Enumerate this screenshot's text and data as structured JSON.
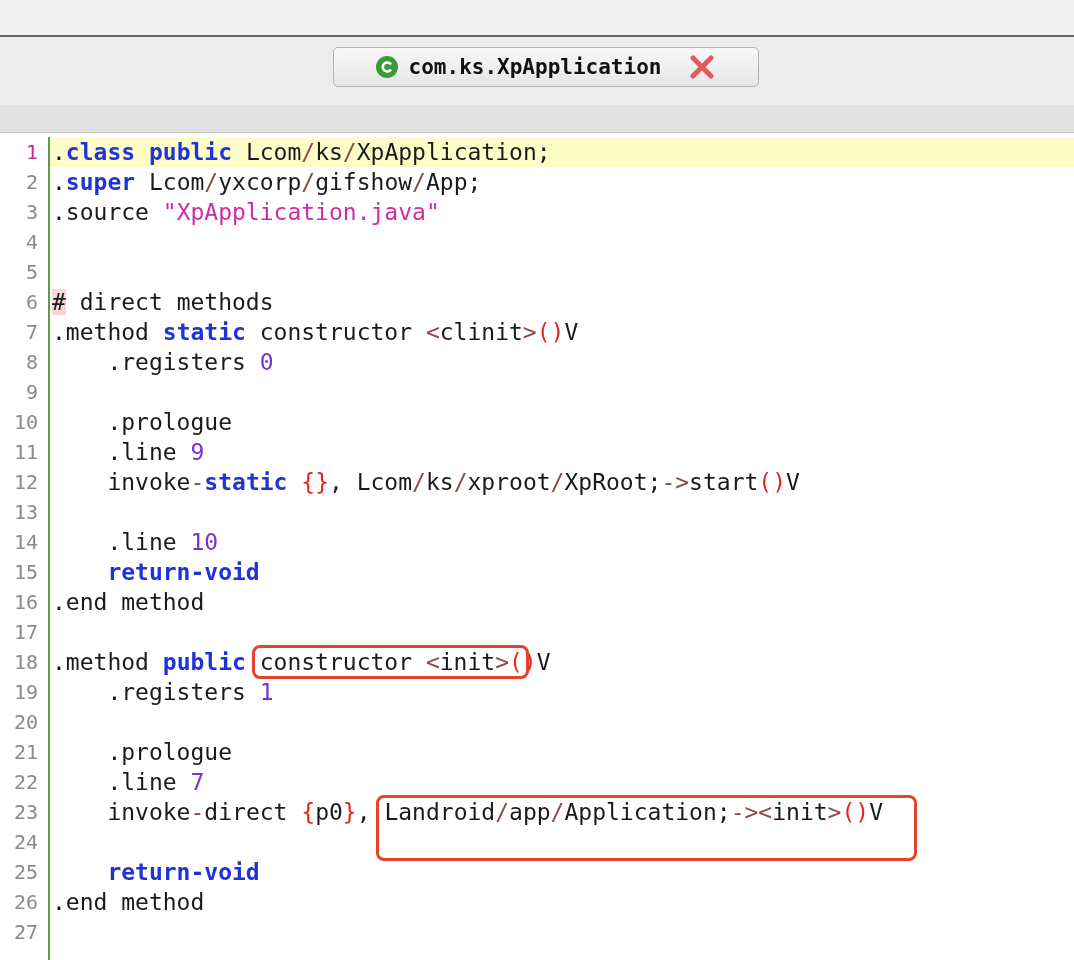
{
  "tab": {
    "title": "com.ks.XpApplication"
  },
  "lines": [
    {
      "number": "1",
      "current": true,
      "tokens": [
        {
          "text": ".",
          "kind": "plain"
        },
        {
          "text": "class ",
          "kind": "keyword"
        },
        {
          "text": "public",
          "kind": "keyword"
        },
        {
          "text": " Lcom",
          "kind": "plain"
        },
        {
          "text": "/",
          "kind": "op"
        },
        {
          "text": "ks",
          "kind": "plain"
        },
        {
          "text": "/",
          "kind": "op"
        },
        {
          "text": "XpApplication;",
          "kind": "plain"
        }
      ]
    },
    {
      "number": "2",
      "current": false,
      "tokens": [
        {
          "text": ".",
          "kind": "plain"
        },
        {
          "text": "super",
          "kind": "keyword"
        },
        {
          "text": " Lcom",
          "kind": "plain"
        },
        {
          "text": "/",
          "kind": "op"
        },
        {
          "text": "yxcorp",
          "kind": "plain"
        },
        {
          "text": "/",
          "kind": "op"
        },
        {
          "text": "gifshow",
          "kind": "plain"
        },
        {
          "text": "/",
          "kind": "op"
        },
        {
          "text": "App;",
          "kind": "plain"
        }
      ]
    },
    {
      "number": "3",
      "current": false,
      "tokens": [
        {
          "text": ".source ",
          "kind": "plain"
        },
        {
          "text": "\"XpApplication.java\"",
          "kind": "string"
        }
      ]
    },
    {
      "number": "4",
      "current": false
    },
    {
      "number": "5",
      "current": false
    },
    {
      "number": "6",
      "current": false,
      "tokens": [
        {
          "text": "#",
          "kind": "mark"
        },
        {
          "text": " direct methods",
          "kind": "plain"
        }
      ]
    },
    {
      "number": "7",
      "current": false,
      "tokens": [
        {
          "text": ".method ",
          "kind": "plain"
        },
        {
          "text": "static",
          "kind": "keyword"
        },
        {
          "text": " constructor ",
          "kind": "plain"
        },
        {
          "text": "<",
          "kind": "op"
        },
        {
          "text": "clinit",
          "kind": "plain"
        },
        {
          "text": ">",
          "kind": "op"
        },
        {
          "text": "()",
          "kind": "paren"
        },
        {
          "text": "V",
          "kind": "plain"
        }
      ]
    },
    {
      "number": "8",
      "current": false,
      "tokens": [
        {
          "text": "    .registers ",
          "kind": "plain"
        },
        {
          "text": "0",
          "kind": "number"
        }
      ]
    },
    {
      "number": "9",
      "current": false
    },
    {
      "number": "10",
      "current": false,
      "tokens": [
        {
          "text": "    .prologue",
          "kind": "plain"
        }
      ]
    },
    {
      "number": "11",
      "current": false,
      "tokens": [
        {
          "text": "    .line ",
          "kind": "plain"
        },
        {
          "text": "9",
          "kind": "number"
        }
      ]
    },
    {
      "number": "12",
      "current": false,
      "tokens": [
        {
          "text": "    invoke",
          "kind": "plain"
        },
        {
          "text": "-",
          "kind": "op"
        },
        {
          "text": "static ",
          "kind": "keyword"
        },
        {
          "text": "{}",
          "kind": "paren"
        },
        {
          "text": ", Lcom",
          "kind": "plain"
        },
        {
          "text": "/",
          "kind": "op"
        },
        {
          "text": "ks",
          "kind": "plain"
        },
        {
          "text": "/",
          "kind": "op"
        },
        {
          "text": "xproot",
          "kind": "plain"
        },
        {
          "text": "/",
          "kind": "op"
        },
        {
          "text": "XpRoot;",
          "kind": "plain"
        },
        {
          "text": "->",
          "kind": "op"
        },
        {
          "text": "start",
          "kind": "plain"
        },
        {
          "text": "()",
          "kind": "paren"
        },
        {
          "text": "V",
          "kind": "plain"
        }
      ]
    },
    {
      "number": "13",
      "current": false
    },
    {
      "number": "14",
      "current": false,
      "tokens": [
        {
          "text": "    .line ",
          "kind": "plain"
        },
        {
          "text": "10",
          "kind": "number"
        }
      ]
    },
    {
      "number": "15",
      "current": false,
      "tokens": [
        {
          "text": "    return-void",
          "kind": "keyword"
        }
      ]
    },
    {
      "number": "16",
      "current": false,
      "tokens": [
        {
          "text": ".end method",
          "kind": "plain"
        }
      ]
    },
    {
      "number": "17",
      "current": false
    },
    {
      "number": "18",
      "current": false,
      "tokens": [
        {
          "text": ".method ",
          "kind": "plain"
        },
        {
          "text": "public ",
          "kind": "keyword"
        }
      ],
      "box": {
        "tall": false,
        "tokens": [
          {
            "text": "constructor ",
            "kind": "plain"
          },
          {
            "text": "<",
            "kind": "op"
          },
          {
            "text": "init",
            "kind": "plain"
          },
          {
            "text": ">",
            "kind": "op"
          },
          {
            "text": "(",
            "kind": "paren"
          }
        ]
      },
      "rest": [
        {
          "text": ")",
          "kind": "paren"
        },
        {
          "text": "V",
          "kind": "plain"
        }
      ]
    },
    {
      "number": "19",
      "current": false,
      "tokens": [
        {
          "text": "    .registers ",
          "kind": "plain"
        },
        {
          "text": "1",
          "kind": "number"
        }
      ]
    },
    {
      "number": "20",
      "current": false
    },
    {
      "number": "21",
      "current": false,
      "tokens": [
        {
          "text": "    .prologue",
          "kind": "plain"
        }
      ]
    },
    {
      "number": "22",
      "current": false,
      "tokens": [
        {
          "text": "    .line ",
          "kind": "plain"
        },
        {
          "text": "7",
          "kind": "number"
        }
      ]
    },
    {
      "number": "23",
      "current": false,
      "tokens": [
        {
          "text": "    invoke",
          "kind": "plain"
        },
        {
          "text": "-",
          "kind": "op"
        },
        {
          "text": "direct ",
          "kind": "plain"
        },
        {
          "text": "{",
          "kind": "paren"
        },
        {
          "text": "p0",
          "kind": "plain"
        },
        {
          "text": "}",
          "kind": "paren"
        },
        {
          "text": ", ",
          "kind": "plain"
        }
      ],
      "box": {
        "tall": true,
        "tokens": [
          {
            "text": "Landroid",
            "kind": "plain"
          },
          {
            "text": "/",
            "kind": "op"
          },
          {
            "text": "app",
            "kind": "plain"
          },
          {
            "text": "/",
            "kind": "op"
          },
          {
            "text": "Application;",
            "kind": "plain"
          },
          {
            "text": "->",
            "kind": "op"
          },
          {
            "text": "<",
            "kind": "op"
          },
          {
            "text": "init",
            "kind": "plain"
          },
          {
            "text": ">",
            "kind": "op"
          },
          {
            "text": "()",
            "kind": "paren"
          },
          {
            "text": "V",
            "kind": "plain"
          }
        ]
      }
    },
    {
      "number": "24",
      "current": false
    },
    {
      "number": "25",
      "current": false,
      "tokens": [
        {
          "text": "    return-void",
          "kind": "keyword"
        }
      ]
    },
    {
      "number": "26",
      "current": false,
      "tokens": [
        {
          "text": ".end method",
          "kind": "plain"
        }
      ]
    },
    {
      "number": "27",
      "current": false
    }
  ]
}
